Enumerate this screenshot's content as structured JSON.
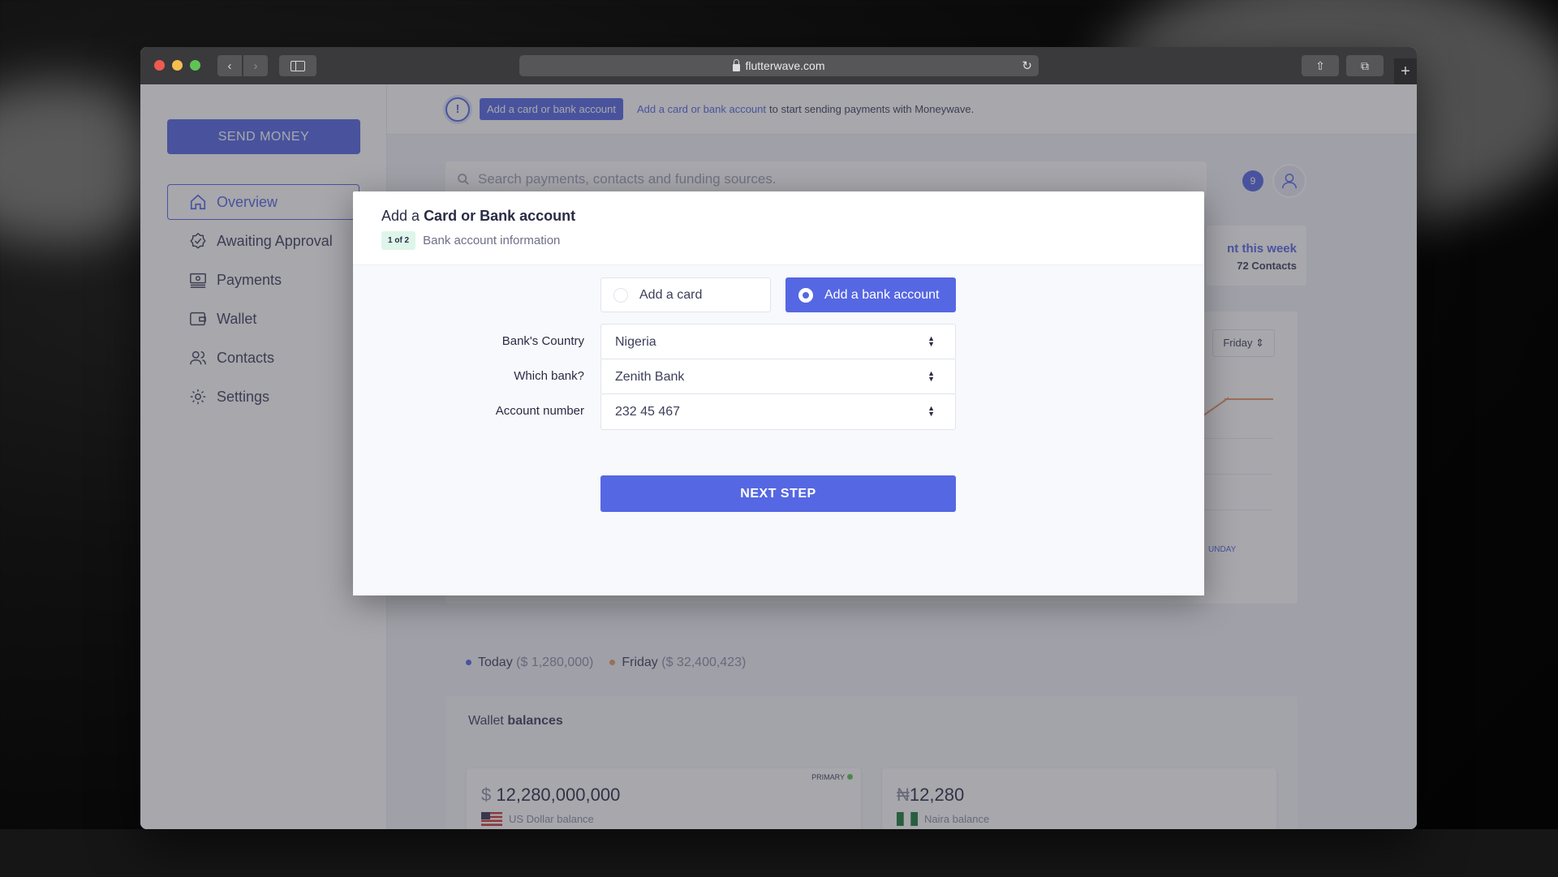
{
  "browser": {
    "url": "flutterwave.com"
  },
  "sidebar": {
    "send_money_label": "SEND MONEY",
    "items": [
      {
        "label": "Overview",
        "icon": "home-icon",
        "active": true
      },
      {
        "label": "Awaiting Approval",
        "icon": "badge-check-icon",
        "active": false
      },
      {
        "label": "Payments",
        "icon": "payments-icon",
        "active": false
      },
      {
        "label": "Wallet",
        "icon": "wallet-icon",
        "active": false
      },
      {
        "label": "Contacts",
        "icon": "contacts-icon",
        "active": false
      },
      {
        "label": "Settings",
        "icon": "gear-icon",
        "active": false
      }
    ]
  },
  "notice": {
    "pill": "Add a card or bank account",
    "link": "Add a card or bank account",
    "text": "to start sending payments with Moneywave."
  },
  "header": {
    "search_placeholder": "Search payments, contacts and funding sources.",
    "notification_count": "9"
  },
  "stats": {
    "week_title": "nt this week",
    "week_sub": "72 Contacts",
    "day_select": "Friday",
    "axis_label": "UNDAY"
  },
  "legend": {
    "today_label": "Today",
    "today_value": "($ 1,280,000)",
    "friday_label": "Friday",
    "friday_value": "($ 32,400,423)"
  },
  "wallet": {
    "title_prefix": "Wallet",
    "title_bold": "balances",
    "balances": [
      {
        "currency": "$",
        "amount": "12,280,000,000",
        "label": "US Dollar balance",
        "tag": "PRIMARY"
      },
      {
        "currency": "₦",
        "amount": "12,280",
        "label": "Naira balance"
      }
    ]
  },
  "modal": {
    "title_prefix": "Add a",
    "title_bold": "Card or Bank account",
    "step": "1 of 2",
    "step_label": "Bank account information",
    "option_card": "Add a card",
    "option_bank": "Add a bank account",
    "country_label_a": "Bank's",
    "country_label_b": "Country",
    "country_value": "Nigeria",
    "bank_label_a": "Which",
    "bank_label_b": "bank?",
    "bank_value": "Zenith Bank",
    "account_label_a": "Account",
    "account_label_b": "number",
    "account_value": "232 45 467",
    "next_label": "NEXT STEP"
  },
  "colors": {
    "accent": "#5567e3",
    "chart_orange": "#e89966",
    "success": "#5fc454"
  }
}
